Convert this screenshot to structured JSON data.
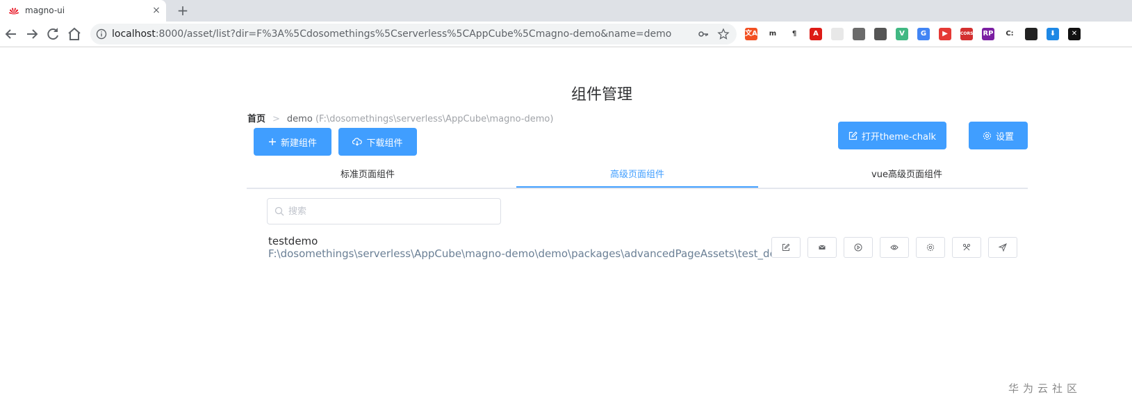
{
  "browser": {
    "tab_title": "magno-ui",
    "tab_close": "×",
    "new_tab": "+",
    "url_host": "localhost",
    "url_rest": ":8000/asset/list?dir=F%3A%5Cdosomethings%5Cserverless%5CAppCube%5Cmagno-demo&name=demo",
    "extensions": [
      {
        "icon": "translate-ext-icon",
        "label": "文A",
        "color": "#f25022"
      },
      {
        "icon": "m-ext-icon",
        "label": "m",
        "color": "#ffffff"
      },
      {
        "icon": "paragraph-ext-icon",
        "label": "¶",
        "color": "#ffffff"
      },
      {
        "icon": "angular-ext-icon",
        "label": "A",
        "color": "#dd1b16"
      },
      {
        "icon": "blank-ext-icon",
        "label": "",
        "color": "#e8e8e8"
      },
      {
        "icon": "cat-ext-icon",
        "label": "",
        "color": "#6b6b6b"
      },
      {
        "icon": "globe-ext-icon",
        "label": "",
        "color": "#555555"
      },
      {
        "icon": "vue-ext-icon",
        "label": "V",
        "color": "#41b883"
      },
      {
        "icon": "google-translate-ext-icon",
        "label": "G",
        "color": "#4285f4"
      },
      {
        "icon": "video-ext-icon",
        "label": "▶",
        "color": "#e53935"
      },
      {
        "icon": "cors-ext-icon",
        "label": "CORS",
        "color": "#d32f2f"
      },
      {
        "icon": "rp-ext-icon",
        "label": "RP",
        "color": "#7b1fa2"
      },
      {
        "icon": "c-ext-icon",
        "label": "C:",
        "color": "#ffffff"
      },
      {
        "icon": "ghost-ext-icon",
        "label": "",
        "color": "#222222"
      },
      {
        "icon": "download-ext-icon",
        "label": "⬇",
        "color": "#1e88e5"
      },
      {
        "icon": "x-ext-icon",
        "label": "✕",
        "color": "#111111"
      }
    ]
  },
  "page": {
    "title": "组件管理",
    "breadcrumb": {
      "home": "首页",
      "current": "demo",
      "path": "(F:\\dosomethings\\serverless\\AppCube\\magno-demo)"
    },
    "buttons": {
      "new": "新建组件",
      "download": "下载组件",
      "open_theme": "打开theme-chalk",
      "settings": "设置"
    },
    "tabs": [
      {
        "label": "标准页面组件",
        "active": false
      },
      {
        "label": "高级页面组件",
        "active": true
      },
      {
        "label": "vue高级页面组件",
        "active": false
      }
    ],
    "search": {
      "placeholder": "搜索",
      "value": ""
    },
    "items": [
      {
        "name": "testdemo",
        "path": "F:\\dosomethings\\serverless\\AppCube\\magno-demo\\demo\\packages\\advancedPageAssets\\test_demo"
      }
    ],
    "accent": "#409eff"
  },
  "watermark": "华为云社区"
}
